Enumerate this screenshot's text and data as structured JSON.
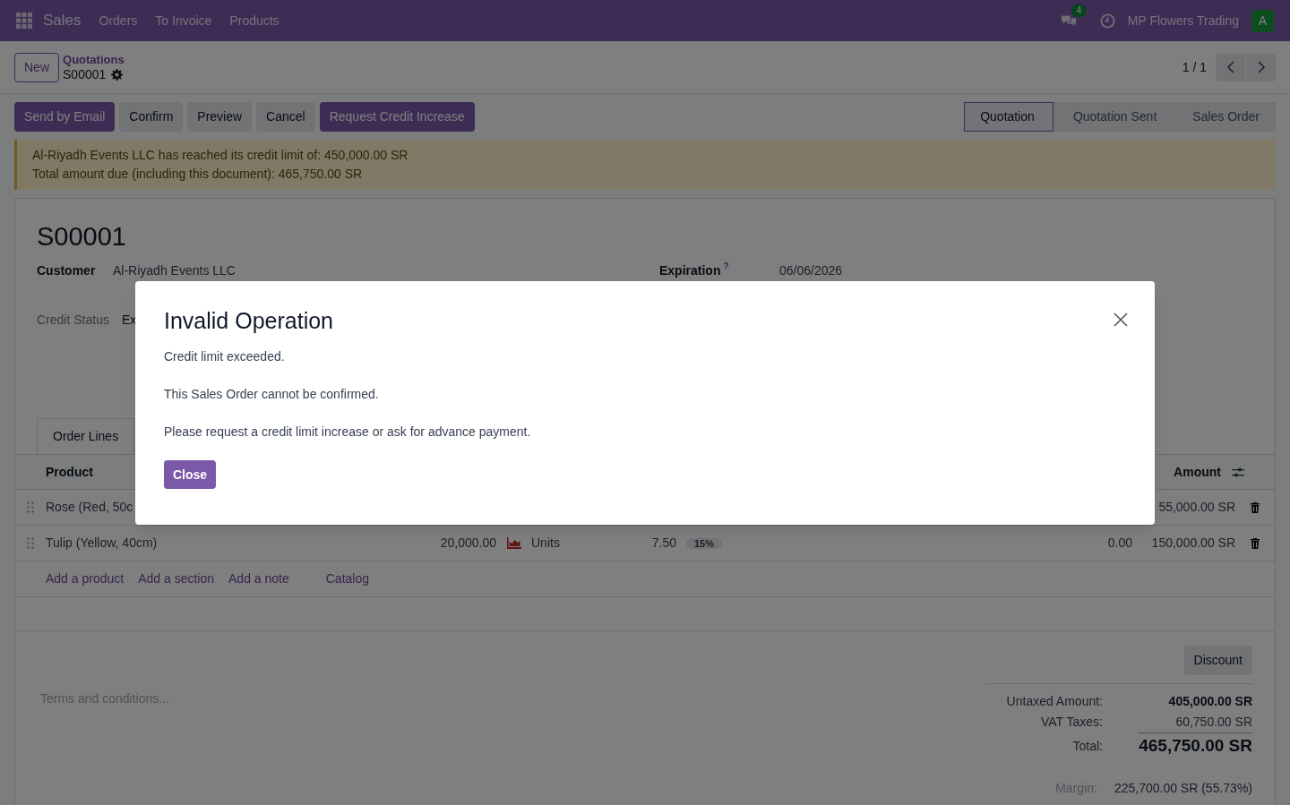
{
  "navbar": {
    "app": "Sales",
    "menus": [
      "Orders",
      "To Invoice",
      "Products"
    ],
    "messages_count": "4",
    "company": "MP Flowers Trading",
    "avatar_letter": "A"
  },
  "control_panel": {
    "new_button": "New",
    "breadcrumb": "Quotations",
    "record": "S00001",
    "pager": "1 / 1"
  },
  "actions": [
    {
      "label": "Send by Email",
      "primary": true
    },
    {
      "label": "Confirm",
      "primary": false
    },
    {
      "label": "Preview",
      "primary": false
    },
    {
      "label": "Cancel",
      "primary": false
    },
    {
      "label": "Request Credit Increase",
      "primary": true
    }
  ],
  "stages": [
    {
      "label": "Quotation",
      "selected": true
    },
    {
      "label": "Quotation Sent",
      "selected": false
    },
    {
      "label": "Sales Order",
      "selected": false
    }
  ],
  "alert": [
    "Al-Riyadh Events LLC has reached its credit limit of: 450,000.00 SR",
    "Total amount due (including this document): 465,750.00 SR"
  ],
  "form": {
    "title": "S00001",
    "customer_label": "Customer",
    "customer": "Al-Riyadh Events LLC",
    "expiration_label": "Expiration",
    "expiration_help": "?",
    "expiration": "06/06/2026",
    "credit_status_label": "Credit Status",
    "credit_status": "Ex"
  },
  "tabs": [
    {
      "label": "Order Lines",
      "selected": true
    }
  ],
  "table": {
    "columns": [
      "Product",
      "Amount"
    ],
    "rows": [
      {
        "product": "Rose (Red, 50c",
        "quantity": "",
        "unit": "",
        "price": "",
        "tax": "",
        "discount": "",
        "amount": "55,000.00 SR"
      },
      {
        "product": "Tulip (Yellow, 40cm)",
        "quantity": "20,000.00",
        "unit": "Units",
        "price": "7.50",
        "tax": "15%",
        "discount": "0.00",
        "amount": "150,000.00 SR"
      }
    ],
    "add_links": [
      "Add a product",
      "Add a section",
      "Add a note",
      "Catalog"
    ]
  },
  "terms_placeholder": "Terms and conditions...",
  "discount_button": "Discount",
  "totals": [
    {
      "label": "Untaxed Amount:",
      "value": "405,000.00 SR",
      "kind": "bold"
    },
    {
      "label": "VAT Taxes:",
      "value": "60,750.00 SR",
      "kind": "plain"
    },
    {
      "label": "Total:",
      "value": "465,750.00 SR",
      "kind": "total"
    }
  ],
  "margin": {
    "label": "Margin:",
    "value": "225,700.00 SR (55.73%)"
  },
  "dialog": {
    "title": "Invalid Operation",
    "paragraphs": [
      "Credit limit exceeded.",
      "This Sales Order cannot be confirmed.",
      "Please request a credit limit increase or ask for advance payment."
    ],
    "close_button": "Close"
  }
}
